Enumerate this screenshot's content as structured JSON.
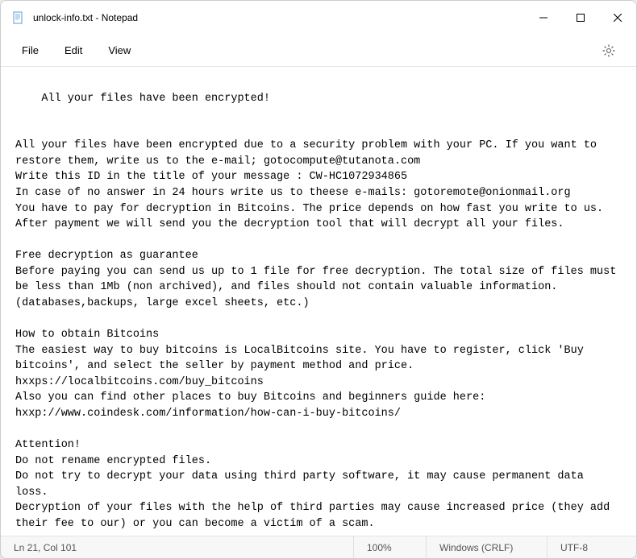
{
  "titlebar": {
    "title": "unlock-info.txt - Notepad"
  },
  "menubar": {
    "file": "File",
    "edit": "Edit",
    "view": "View"
  },
  "content": {
    "text": "All your files have been encrypted!\n\n\nAll your files have been encrypted due to a security problem with your PC. If you want to restore them, write us to the e-mail; gotocompute@tutanota.com\nWrite this ID in the title of your message : CW-HC1072934865\nIn case of no answer in 24 hours write us to theese e-mails: gotoremote@onionmail.org\nYou have to pay for decryption in Bitcoins. The price depends on how fast you write to us. After payment we will send you the decryption tool that will decrypt all your files.\n\nFree decryption as guarantee\nBefore paying you can send us up to 1 file for free decryption. The total size of files must be less than 1Mb (non archived), and files should not contain valuable information. (databases,backups, large excel sheets, etc.)\n\nHow to obtain Bitcoins\nThe easiest way to buy bitcoins is LocalBitcoins site. You have to register, click 'Buy bitcoins', and select the seller by payment method and price.\nhxxps://localbitcoins.com/buy_bitcoins\nAlso you can find other places to buy Bitcoins and beginners guide here:\nhxxp://www.coindesk.com/information/how-can-i-buy-bitcoins/\n\nAttention!\nDo not rename encrypted files.\nDo not try to decrypt your data using third party software, it may cause permanent data loss.\nDecryption of your files with the help of third parties may cause increased price (they add their fee to our) or you can become a victim of a scam."
  },
  "statusbar": {
    "position": "Ln 21, Col 101",
    "zoom": "100%",
    "lineending": "Windows (CRLF)",
    "encoding": "UTF-8"
  }
}
